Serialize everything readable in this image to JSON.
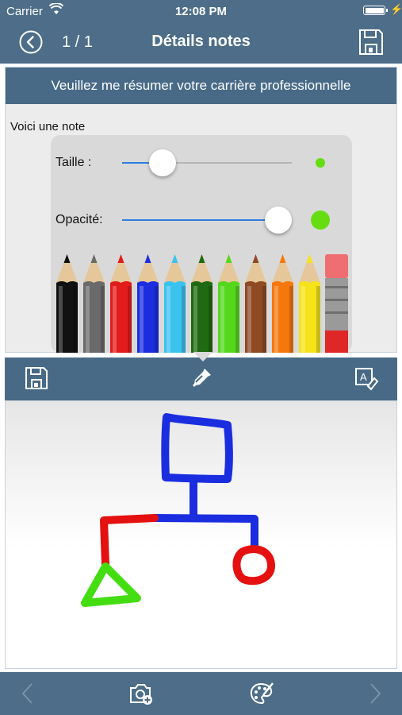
{
  "status_bar": {
    "carrier": "Carrier",
    "time": "12:08 PM"
  },
  "navbar": {
    "counter": "1 / 1",
    "title": "Détails notes",
    "back_icon": "back-circle-icon",
    "save_icon": "floppy-disk-icon"
  },
  "question": {
    "text": "Veuillez me résumer votre carrière professionnelle"
  },
  "note": {
    "text": "Voici une note"
  },
  "popover": {
    "size_label": "Taille :",
    "size_value": 0.24,
    "opacity_label": "Opacité:",
    "opacity_value": 0.92,
    "preview_color": "#66dd11",
    "pencils": [
      {
        "name": "black",
        "color": "#111111"
      },
      {
        "name": "gray",
        "color": "#6a6a6a"
      },
      {
        "name": "red",
        "color": "#e21b1b"
      },
      {
        "name": "blue",
        "color": "#1a2ee0"
      },
      {
        "name": "light-blue",
        "color": "#3cc2ef"
      },
      {
        "name": "dark-green",
        "color": "#1f6a12"
      },
      {
        "name": "green",
        "color": "#55d81c"
      },
      {
        "name": "brown",
        "color": "#8e4a23"
      },
      {
        "name": "orange",
        "color": "#f5780e"
      },
      {
        "name": "yellow",
        "color": "#f6e31a"
      },
      {
        "name": "eraser",
        "color": "#e02727"
      }
    ]
  },
  "draw_toolbar": {
    "items": [
      "floppy-disk-icon",
      "eyedropper-icon",
      "clear-drawing-icon"
    ]
  },
  "drawing": {
    "colors": {
      "blue": "#1a2ee0",
      "red": "#e51010",
      "green": "#44dd11"
    }
  },
  "bottom_bar": {
    "items": [
      "chevron-left-icon",
      "add-photo-icon",
      "palette-icon",
      "chevron-right-icon"
    ]
  }
}
